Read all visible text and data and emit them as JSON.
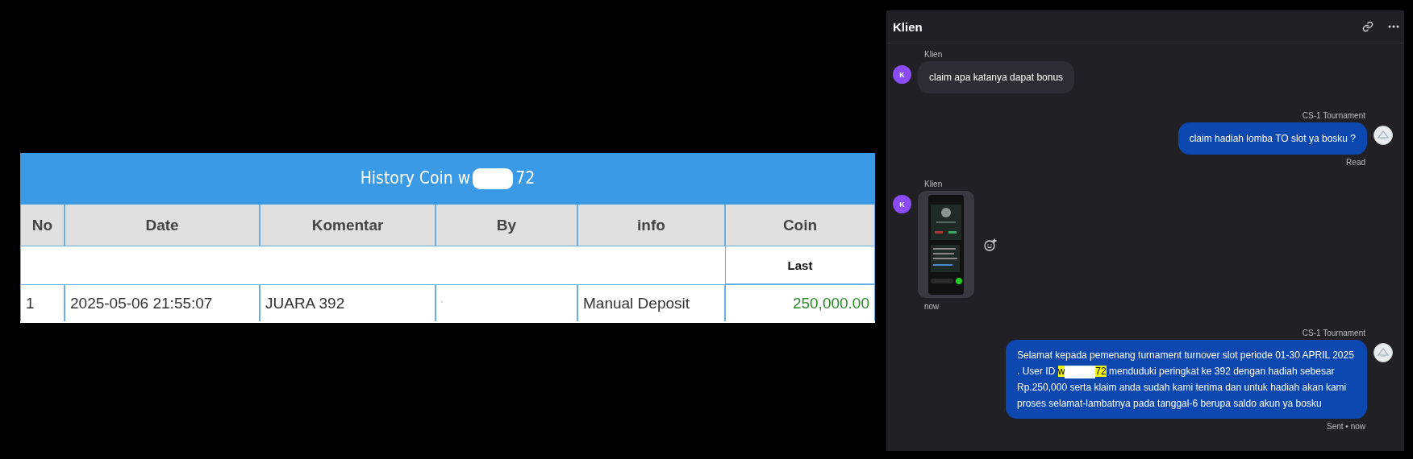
{
  "history_table": {
    "title_prefix": "History Coin w",
    "title_suffix": "72",
    "columns": [
      "No",
      "Date",
      "Komentar",
      "By",
      "info",
      "Coin"
    ],
    "subheader": "Last",
    "rows": [
      {
        "no": "1",
        "date": "2025-05-06 21:55:07",
        "komentar": "JUARA 392",
        "by": "'",
        "info": "Manual Deposit",
        "coin": "250,000.00"
      }
    ]
  },
  "chat": {
    "title": "Klien",
    "messages": [
      {
        "kind": "text",
        "outgoing": false,
        "sender": "Klien",
        "avatar": "K",
        "text": "claim apa katanya dapat bonus"
      },
      {
        "kind": "text",
        "outgoing": true,
        "sender": "CS-1 Tournament",
        "text": "claim hadiah lomba TO slot ya bosku ?",
        "status": "Read"
      },
      {
        "outgoing": false,
        "sender": "Klien",
        "avatar": "K",
        "time": "now"
      },
      {
        "kind": "long",
        "outgoing": true,
        "sender": "CS-1 Tournament",
        "text_before": "Selamat kepada pemenang turnament turnover slot periode 01-30 APRIL 2025 . User ID",
        "highlight_prefix": "w",
        "highlight_suffix": "72",
        "text_after": "menduduki peringkat ke 392 dengan hadiah sebesar Rp.250,000 serta klaim anda sudah kami terima dan untuk hadiah akan kami proses selamat-lambatnya pada tanggal-6 berupa saldo akun ya bosku",
        "status": "Sent • now"
      }
    ]
  }
}
